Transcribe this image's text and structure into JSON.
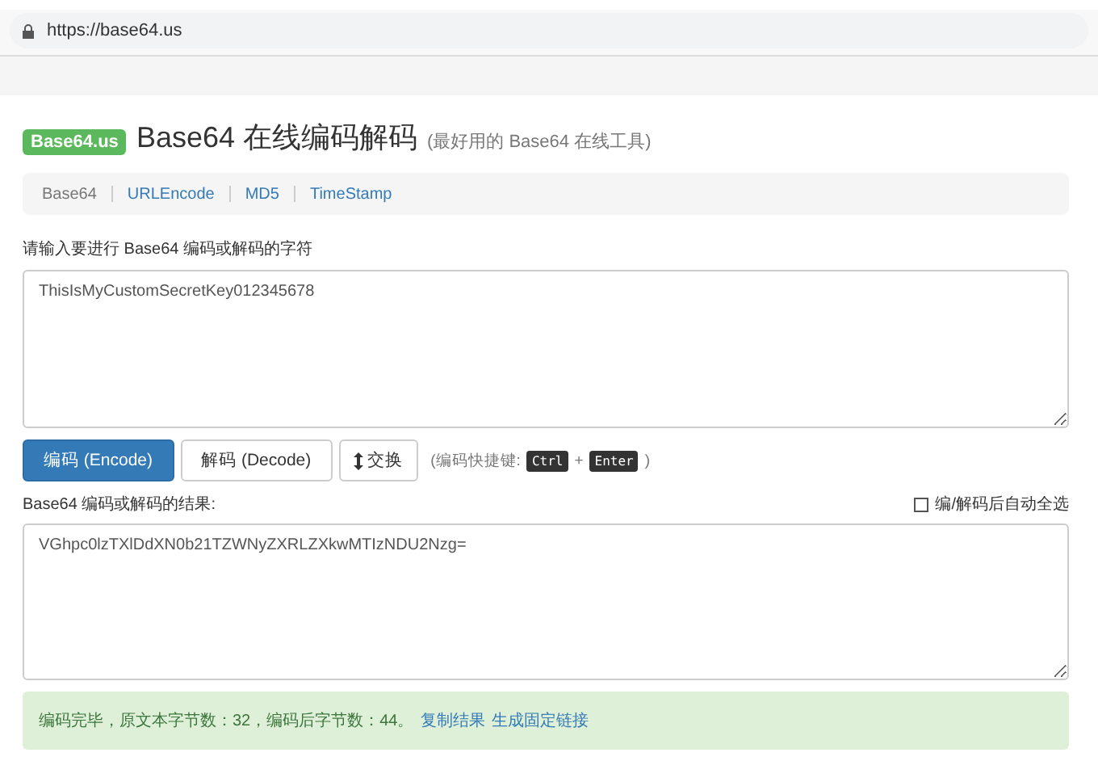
{
  "browser": {
    "url": "https://base64.us"
  },
  "header": {
    "badge": "Base64.us",
    "title": "Base64 在线编码解码",
    "subtitle": "(最好用的 Base64 在线工具)"
  },
  "nav": [
    {
      "label": "Base64",
      "selected": true
    },
    {
      "label": "URLEncode",
      "selected": false
    },
    {
      "label": "MD5",
      "selected": false
    },
    {
      "label": "TimeStamp",
      "selected": false
    }
  ],
  "input": {
    "label": "请输入要进行 Base64 编码或解码的字符",
    "value": "ThisIsMyCustomSecretKey012345678"
  },
  "buttons": [
    {
      "kind": "primary",
      "label": "编码 (Encode)"
    },
    {
      "kind": "default",
      "label": "解码 (Decode)"
    },
    {
      "kind": "swap",
      "label": "交换"
    }
  ],
  "shortcut": {
    "prefix": "(编码快捷键:",
    "keys": [
      "Ctrl",
      "Enter"
    ],
    "joiner": "+",
    "suffix": ")"
  },
  "output": {
    "label": "Base64 编码或解码的结果:",
    "auto_select": {
      "label": "编/解码后自动全选",
      "checked": false
    },
    "value": "VGhpc0lzTXlDdXN0b21TZWNyZXRLZXkwMTIzNDU2Nzg="
  },
  "status": {
    "message": "编码完毕，原文本字节数：32，编码后字节数：44。",
    "links": [
      "复制结果",
      "生成固定链接"
    ]
  }
}
